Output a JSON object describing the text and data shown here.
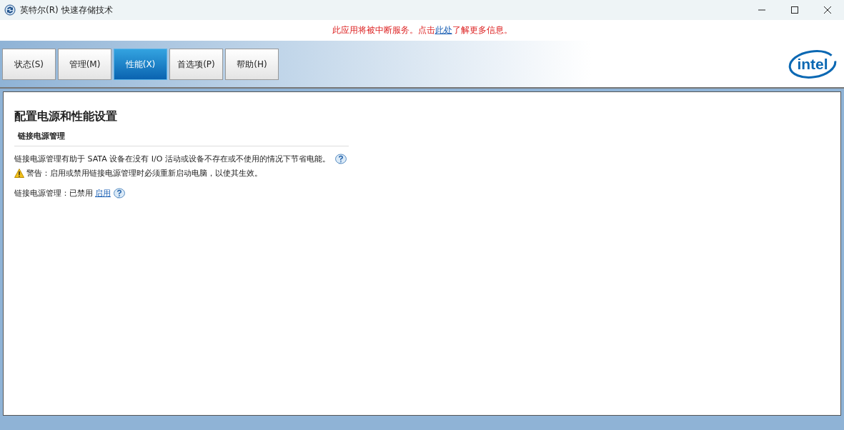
{
  "window": {
    "title": "英特尔(R) 快速存储技术"
  },
  "notice": {
    "before": "此应用将被中断服务。点击",
    "link": "此处",
    "after": "了解更多信息。"
  },
  "tabs": [
    {
      "label": "状态(S)",
      "selected": false
    },
    {
      "label": "管理(M)",
      "selected": false
    },
    {
      "label": "性能(X)",
      "selected": true
    },
    {
      "label": "首选项(P)",
      "selected": false
    },
    {
      "label": "帮助(H)",
      "selected": false
    }
  ],
  "logo": "intel",
  "page": {
    "heading": "配置电源和性能设置",
    "section": "链接电源管理",
    "description": "链接电源管理有助于 SATA 设备在没有 I/O 活动或设备不存在或不使用的情况下节省电能。",
    "warning": "警告：启用或禁用链接电源管理时必须重新启动电脑，以使其生效。",
    "status_label": "链接电源管理：已禁用",
    "status_action": "启用"
  }
}
